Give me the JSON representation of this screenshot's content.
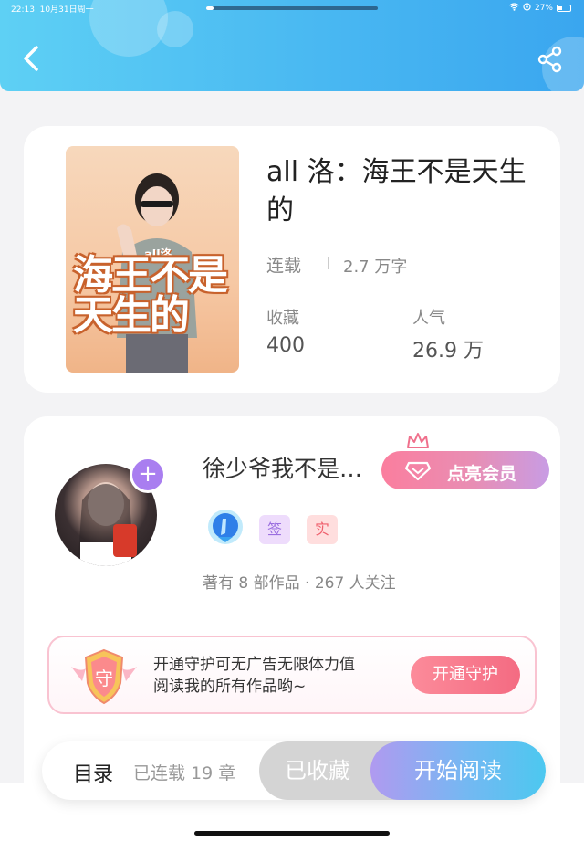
{
  "status_bar": {
    "time": "22:13",
    "date": "10月31日周一",
    "battery": "27%"
  },
  "header": {
    "back_icon": "chevron-left-icon",
    "share_icon": "share-icon",
    "bg_color": "#49b8f2"
  },
  "book": {
    "title": "all 洛：海王不是天生的",
    "cover_title": "海王不是天生的",
    "cover_subtitle": "all洛",
    "status": "连载",
    "word_count": "2.7 万字",
    "stats": [
      {
        "label": "收藏",
        "value": "400"
      },
      {
        "label": "人气",
        "value": "26.9 万"
      }
    ]
  },
  "author": {
    "name": "徐少爷我不是…",
    "vip_button": "点亮会员",
    "tags": [
      "签",
      "实"
    ],
    "meta": "著有 8 部作品 · 267 人关注",
    "follow_icon": "plus-icon"
  },
  "guard": {
    "shield_char": "守",
    "line1": "开通守护可无广告无限体力值",
    "line2": "阅读我的所有作品哟~",
    "button": "开通守护"
  },
  "bottom_bar": {
    "toc_label": "目录",
    "toc_count": "已连载 19 章",
    "favorited": "已收藏",
    "start_reading": "开始阅读"
  }
}
